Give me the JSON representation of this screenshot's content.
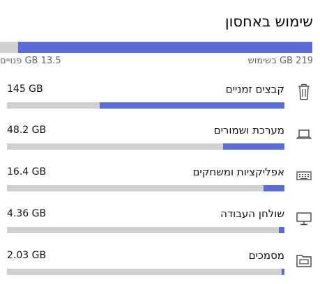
{
  "header": {
    "title": "שימוש באחסון"
  },
  "total": {
    "used_label": "219 GB בשימוש",
    "free_label": "13.5 GB פנויים",
    "used_fraction": 0.943
  },
  "categories": [
    {
      "name": "קבצים זמניים",
      "size": "145 GB",
      "fraction": 0.665,
      "icon": "trash-icon"
    },
    {
      "name": "מערכת ושמורים",
      "size": "48.2 GB",
      "fraction": 0.221,
      "icon": "laptop-icon"
    },
    {
      "name": "אפליקציות ומשחקים",
      "size": "16.4 GB",
      "fraction": 0.075,
      "icon": "keyboard-icon"
    },
    {
      "name": "שולחן העבודה",
      "size": "4.36 GB",
      "fraction": 0.02,
      "icon": "monitor-icon"
    },
    {
      "name": "מסמכים",
      "size": "2.03 GB",
      "fraction": 0.009,
      "icon": "folder-icon"
    }
  ],
  "colors": {
    "accent": "#5b6cd6",
    "track": "#cfcfcf"
  }
}
